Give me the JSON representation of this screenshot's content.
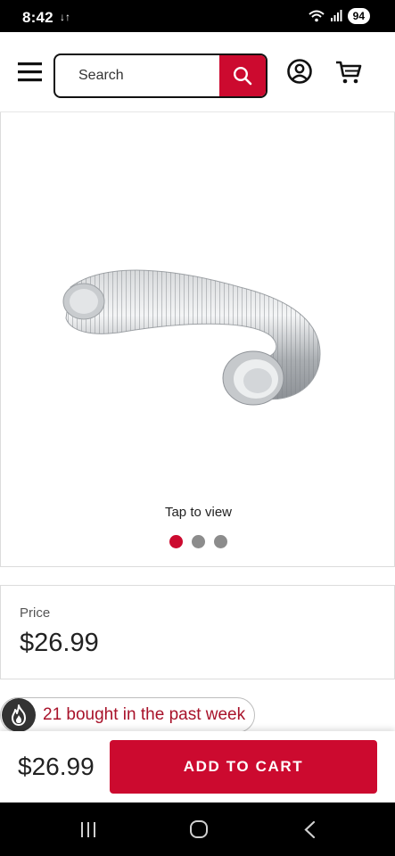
{
  "status_bar": {
    "time": "8:42",
    "notification": "↓↑",
    "battery": "94"
  },
  "header": {
    "search": {
      "placeholder": "Search",
      "value": ""
    },
    "icons": {
      "menu": "hamburger-menu-icon",
      "search": "search-icon",
      "account": "account-icon",
      "cart": "cart-icon"
    }
  },
  "gallery": {
    "image": "flexible-aluminum-duct",
    "tap_label": "Tap to view",
    "slides": 3,
    "active_slide": 1
  },
  "price_card": {
    "label": "Price",
    "value": "$26.99"
  },
  "social_proof": {
    "icon": "flame-icon",
    "text": "21 bought in the past week"
  },
  "bottom_bar": {
    "price": "$26.99",
    "add_to_cart": "ADD TO CART"
  },
  "colors": {
    "brand_red": "#cc0a2f",
    "social_text": "#a8122a"
  }
}
